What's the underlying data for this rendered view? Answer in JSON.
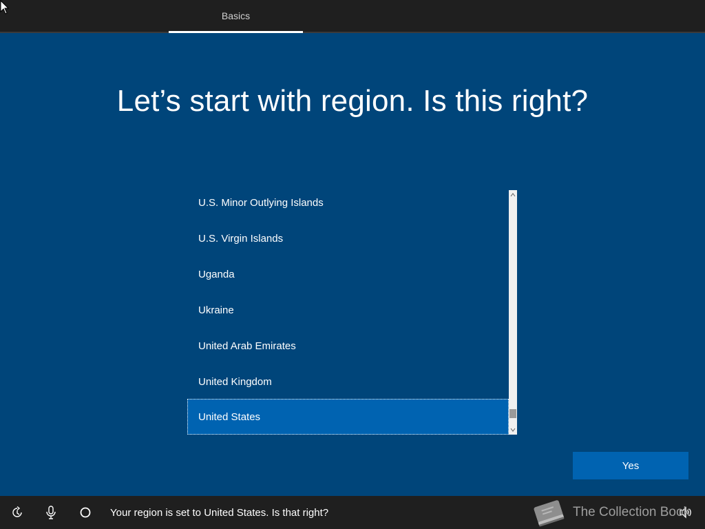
{
  "header": {
    "tabs": [
      {
        "label": "Basics",
        "active": true
      }
    ]
  },
  "page": {
    "title": "Let’s start with region. Is this right?"
  },
  "region_list": {
    "items": [
      {
        "label": "U.S. Minor Outlying Islands",
        "selected": false
      },
      {
        "label": "U.S. Virgin Islands",
        "selected": false
      },
      {
        "label": "Uganda",
        "selected": false
      },
      {
        "label": "Ukraine",
        "selected": false
      },
      {
        "label": "United Arab Emirates",
        "selected": false
      },
      {
        "label": "United Kingdom",
        "selected": false
      },
      {
        "label": "United States",
        "selected": true
      }
    ]
  },
  "actions": {
    "yes_label": "Yes"
  },
  "bottom_bar": {
    "status_text": "Your region is set to United States. Is that right?",
    "icons": [
      "ease-of-access-icon",
      "microphone-icon",
      "cortana-icon",
      "volume-icon"
    ]
  },
  "watermark": {
    "text": "The Collection Book"
  },
  "colors": {
    "background": "#00457a",
    "accent": "#0063b1",
    "bar": "#1f1f1f"
  }
}
